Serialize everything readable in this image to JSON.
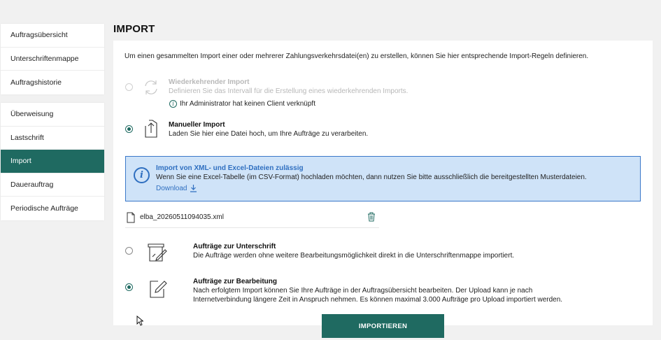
{
  "sidebar": {
    "group1": [
      {
        "label": "Auftragsübersicht"
      },
      {
        "label": "Unterschriftenmappe"
      },
      {
        "label": "Auftragshistorie"
      }
    ],
    "group2": [
      {
        "label": "Überweisung"
      },
      {
        "label": "Lastschrift"
      },
      {
        "label": "Import",
        "active": true
      },
      {
        "label": "Dauerauftrag"
      },
      {
        "label": "Periodische Aufträge"
      }
    ]
  },
  "page": {
    "title": "IMPORT",
    "intro": "Um einen gesammelten Import einer oder mehrerer Zahlungsverkehrsdatei(en) zu erstellen, können Sie hier entsprechende Import-Regeln definieren."
  },
  "options": {
    "recurring": {
      "title": "Wiederkehrender Import",
      "desc": "Definieren Sie das Intervall für die Erstellung eines wiederkehrenden Imports.",
      "hint": "Ihr Administrator hat keinen Client verknüpft",
      "icon": "refresh-icon"
    },
    "manual": {
      "title": "Manueller Import",
      "desc": "Laden Sie hier eine Datei hoch, um Ihre Aufträge zu verarbeiten.",
      "icon": "upload-file-icon"
    }
  },
  "info": {
    "title": "Import von XML- und Excel-Dateien zulässig",
    "text": "Wenn Sie eine Excel-Tabelle (im CSV-Format) hochladen möchten, dann nutzen Sie bitte ausschließlich die bereitgestellten Musterdateien.",
    "link": "Download"
  },
  "file": {
    "name": "elba_20260511094035.xml"
  },
  "targets": {
    "signature": {
      "title": "Aufträge zur Unterschrift",
      "desc": "Die Aufträge werden ohne weitere Bearbeitungsmöglichkeit direkt in die Unterschriftenmappe importiert."
    },
    "edit": {
      "title": "Aufträge zur Bearbeitung",
      "desc1": "Nach erfolgtem Import können Sie Ihre Aufträge in der Auftragsübersicht bearbeiten. Der Upload kann je nach",
      "desc2": "Internetverbindung längere Zeit in Anspruch nehmen. Es können maximal 3.000 Aufträge pro Upload importiert werden."
    }
  },
  "actions": {
    "submit": "IMPORTIEREN"
  },
  "colors": {
    "primary": "#1f6a61",
    "info_bg": "#cfe3f8",
    "info_border": "#3a78c9",
    "link": "#2f6fc0"
  }
}
